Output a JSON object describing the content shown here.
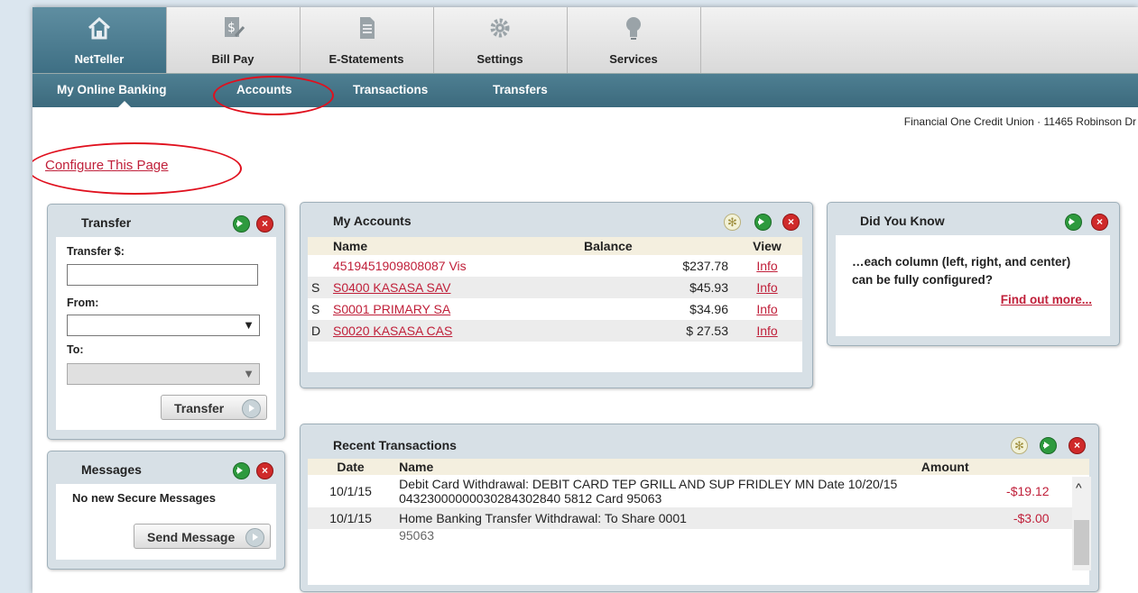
{
  "top_tabs": [
    {
      "label": "NetTeller",
      "icon": "home-icon",
      "active": true
    },
    {
      "label": "Bill Pay",
      "icon": "bill-pay-icon",
      "active": false
    },
    {
      "label": "E-Statements",
      "icon": "document-icon",
      "active": false
    },
    {
      "label": "Settings",
      "icon": "gear-icon",
      "active": false
    },
    {
      "label": "Services",
      "icon": "lightbulb-icon",
      "active": false
    }
  ],
  "sub_nav": [
    "My Online Banking",
    "Accounts",
    "Transactions",
    "Transfers"
  ],
  "institution_line": "Financial One Credit Union · 11465 Robinson Dr",
  "configure_link": "Configure This Page",
  "transfer_panel": {
    "title": "Transfer",
    "amount_label": "Transfer $:",
    "amount_value": "",
    "from_label": "From:",
    "to_label": "To:",
    "button": "Transfer"
  },
  "messages_panel": {
    "title": "Messages",
    "status": "No new Secure Messages",
    "button": "Send Message"
  },
  "accounts_panel": {
    "title": "My Accounts",
    "headers": {
      "name": "Name",
      "balance": "Balance",
      "view": "View"
    },
    "rows": [
      {
        "type": "",
        "name": "4519451909808087 Vis",
        "balance": "$237.78",
        "view": "Info"
      },
      {
        "type": "S",
        "name": "S0400 KASASA SAV",
        "balance": "$45.93",
        "view": "Info"
      },
      {
        "type": "S",
        "name": "S0001 PRIMARY SA",
        "balance": "$34.96",
        "view": "Info"
      },
      {
        "type": "D",
        "name": "S0020 KASASA CAS",
        "balance": "$ 27.53",
        "view": "Info"
      }
    ]
  },
  "did_you_know": {
    "title": "Did You Know",
    "text": "…each column (left, right, and center) can be fully configured?",
    "link": "Find out more..."
  },
  "transactions_panel": {
    "title": "Recent Transactions",
    "headers": {
      "date": "Date",
      "name": "Name",
      "amount": "Amount"
    },
    "rows": [
      {
        "date": "10/1/15",
        "name": "Debit Card Withdrawal: DEBIT CARD TEP GRILL AND SUP FRIDLEY MN Date 10/20/15 04323000000030284302840 5812 Card 95063",
        "amount": "-$19.12"
      },
      {
        "date": "10/1/15",
        "name": "Home Banking Transfer Withdrawal: To Share 0001",
        "amount": "-$3.00"
      }
    ],
    "partial_row": "95063"
  },
  "colors": {
    "accent_red": "#c0203a",
    "subnav": "#467689",
    "annotation": "#e0101e"
  }
}
